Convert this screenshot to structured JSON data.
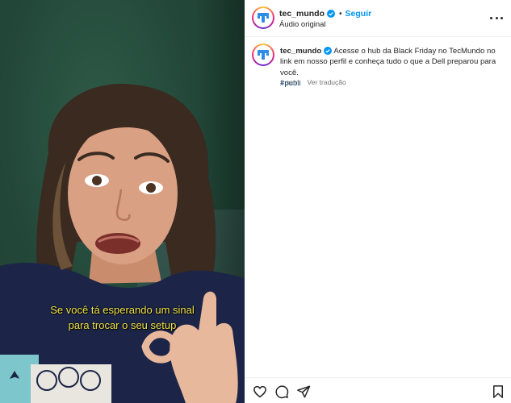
{
  "post": {
    "username": "tec_mundo",
    "follow_label": "Seguir",
    "separator": "•",
    "audio_label": "Áudio original"
  },
  "video": {
    "caption_line1": "Se você tá esperando um sinal",
    "caption_line2": "para trocar o seu setup"
  },
  "comment": {
    "username": "tec_mundo",
    "text": " Acesse o hub da Black Friday no TecMundo no link em nosso perfil e conheça tudo o que a Dell preparou para você.",
    "hashtag": "#publi",
    "time": "1 sem",
    "translate_label": "Ver tradução"
  },
  "actions": {
    "icons": [
      "heart-icon",
      "comment-icon",
      "share-icon",
      "bookmark-icon"
    ]
  },
  "colors": {
    "accent": "#0095f6",
    "logo_blue": "#2d8ce6",
    "caption_yellow": "#f2e34a",
    "verified": "#0095f6"
  }
}
